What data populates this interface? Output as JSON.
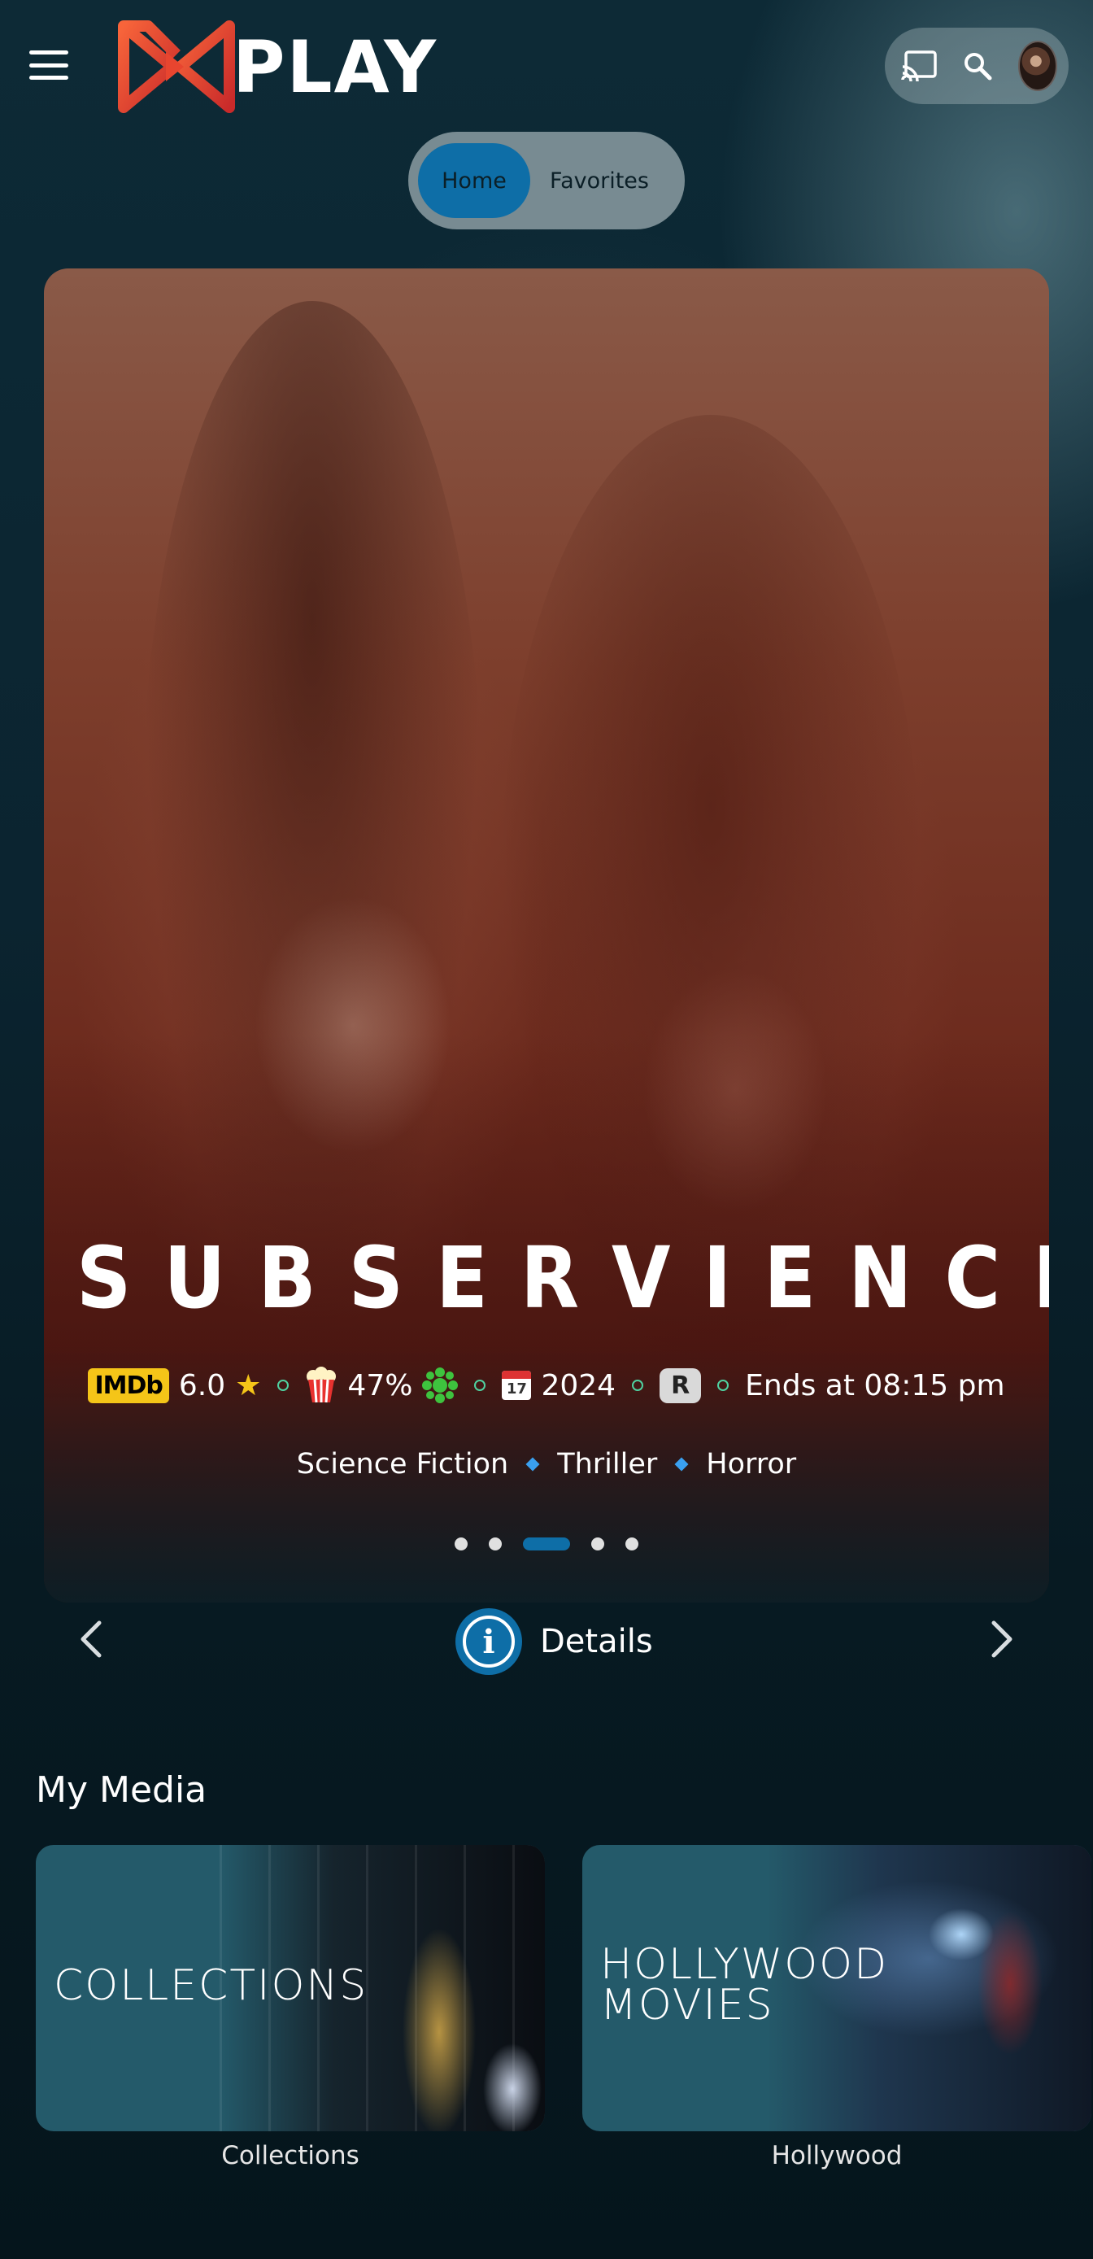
{
  "header": {
    "logo_text": "PLAY",
    "icons": [
      "menu-icon",
      "cast-icon",
      "search-icon",
      "avatar"
    ]
  },
  "tabs": [
    {
      "label": "Home",
      "active": true
    },
    {
      "label": "Favorites",
      "active": false
    }
  ],
  "hero": {
    "title": "SUBSERVIENCE",
    "imdb_label": "IMDb",
    "imdb_score": "6.0",
    "rt_score": "47%",
    "year": "2024",
    "rating": "R",
    "ends_at": "Ends at 08:15 pm",
    "genres": [
      "Science Fiction",
      "Thriller",
      "Horror"
    ],
    "carousel": {
      "count": 5,
      "active_index": 2
    }
  },
  "details": {
    "label": "Details"
  },
  "my_media": {
    "title": "My Media",
    "cards": [
      {
        "label": "COLLECTIONS",
        "caption": "Collections"
      },
      {
        "label_line1": "HOLLYWOOD",
        "label_line2": "MOVIES",
        "caption": "Hollywood"
      }
    ]
  },
  "colors": {
    "accent": "#0e6ea7",
    "imdb": "#f5c518",
    "separator": "#4fd1a0",
    "card_bg": "#245a6a"
  }
}
